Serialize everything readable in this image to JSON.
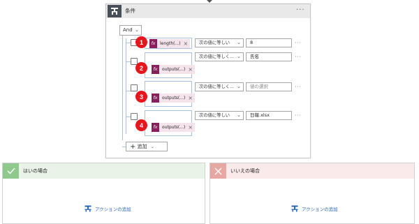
{
  "condition": {
    "title": "条件",
    "menu": "···",
    "group_operator": "And",
    "add_button_label": "追加",
    "rows": [
      {
        "badge": "1",
        "token": "length(...)",
        "operator": "次の値に等しい",
        "value": "8",
        "placeholder": ""
      },
      {
        "badge": "2",
        "token": "outputs(...)",
        "operator": "次の値に等しく...",
        "value": "氏名",
        "placeholder": ""
      },
      {
        "badge": "3",
        "token": "outputs(...)",
        "operator": "次の値に等しく...",
        "value": "",
        "placeholder": "値の選択"
      },
      {
        "badge": "4",
        "token": "outputs(...)",
        "operator": "次の値に等しい",
        "value": "日報.xlsx",
        "placeholder": ""
      }
    ],
    "row_more": "···",
    "fx_label": "fx"
  },
  "branches": {
    "yes": {
      "title": "はいの場合",
      "add_action": "アクションの追加",
      "color": "#8fc98d"
    },
    "no": {
      "title": "いいえの場合",
      "add_action": "アクションの追加",
      "color": "#e7a8a4"
    }
  },
  "colors": {
    "badge": "#e8151c",
    "token_icon": "#8a1f5c",
    "link": "#2b64b3"
  }
}
